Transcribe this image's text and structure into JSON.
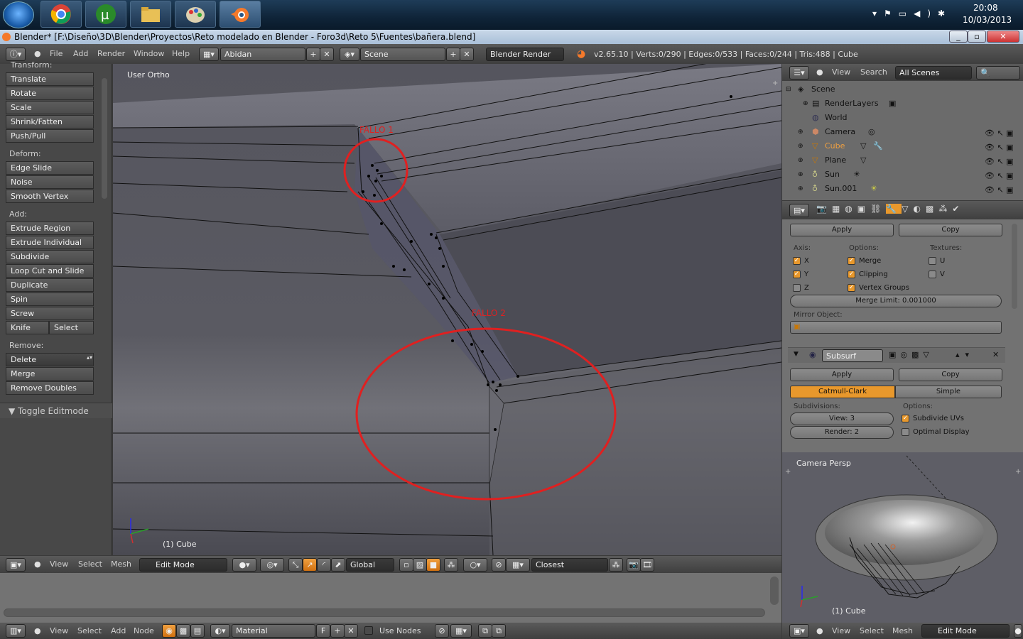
{
  "taskbar": {
    "clock_time": "20:08",
    "clock_date": "10/03/2013"
  },
  "window": {
    "title": "Blender* [F:\\Diseño\\3D\\Blender\\Proyectos\\Reto modelado en Blender - Foro3d\\Reto 5\\Fuentes\\bañera.blend]"
  },
  "info_header": {
    "menus": [
      "File",
      "Add",
      "Render",
      "Window",
      "Help"
    ],
    "screen_layout": "Abidan",
    "scene": "Scene",
    "engine": "Blender Render",
    "stats": "v2.65.10 | Verts:0/290 | Edges:0/533 | Faces:0/244 | Tris:488 | Cube"
  },
  "toolshelf": {
    "transform_label": "Transform:",
    "transform": [
      "Translate",
      "Rotate",
      "Scale",
      "Shrink/Fatten",
      "Push/Pull"
    ],
    "deform_label": "Deform:",
    "deform": [
      "Edge Slide",
      "Noise",
      "Smooth Vertex"
    ],
    "add_label": "Add:",
    "add": [
      "Extrude Region",
      "Extrude Individual",
      "Subdivide",
      "Loop Cut and Slide",
      "Duplicate",
      "Spin",
      "Screw"
    ],
    "knife": "Knife",
    "knife_select": "Select",
    "remove_label": "Remove:",
    "delete": "Delete",
    "merge": "Merge",
    "remove_doubles": "Remove Doubles",
    "toggle_editmode": "Toggle Editmode"
  },
  "viewport": {
    "view_name": "User Ortho",
    "object_label": "(1) Cube",
    "annotation1": "FALLO 1",
    "annotation2": "FALLO 2",
    "annotation_color": "#e02020"
  },
  "view3d_header": {
    "menus": [
      "View",
      "Select",
      "Mesh"
    ],
    "mode": "Edit Mode",
    "orientation": "Global",
    "snap_target": "Closest"
  },
  "outliner": {
    "menus": [
      "View",
      "Search"
    ],
    "display": "All Scenes",
    "items": [
      {
        "name": "Scene"
      },
      {
        "name": "RenderLayers"
      },
      {
        "name": "World"
      },
      {
        "name": "Camera"
      },
      {
        "name": "Cube"
      },
      {
        "name": "Plane"
      },
      {
        "name": "Sun"
      },
      {
        "name": "Sun.001"
      }
    ]
  },
  "mirror_modifier": {
    "apply": "Apply",
    "copy": "Copy",
    "axis_label": "Axis:",
    "options_label": "Options:",
    "textures_label": "Textures:",
    "x": "X",
    "y": "Y",
    "z": "Z",
    "merge": "Merge",
    "clipping": "Clipping",
    "vertex_groups": "Vertex Groups",
    "u": "U",
    "v": "V",
    "merge_limit": "Merge Limit: 0.001000",
    "mirror_object_label": "Mirror Object:"
  },
  "subsurf_modifier": {
    "name": "Subsurf",
    "apply": "Apply",
    "copy": "Copy",
    "catmull": "Catmull-Clark",
    "simple": "Simple",
    "subdivisions_label": "Subdivisions:",
    "options_label": "Options:",
    "view": "View: 3",
    "render": "Render: 2",
    "subdivide_uvs": "Subdivide UVs",
    "optimal_display": "Optimal Display"
  },
  "camera_view": {
    "name": "Camera Persp",
    "object_label": "(1) Cube"
  },
  "node_header": {
    "menus": [
      "View",
      "Select",
      "Add",
      "Node"
    ],
    "material": "Material",
    "fake_user": "F",
    "use_nodes": "Use Nodes"
  },
  "cam_header": {
    "menus": [
      "View",
      "Select",
      "Mesh"
    ],
    "mode": "Edit Mode"
  }
}
